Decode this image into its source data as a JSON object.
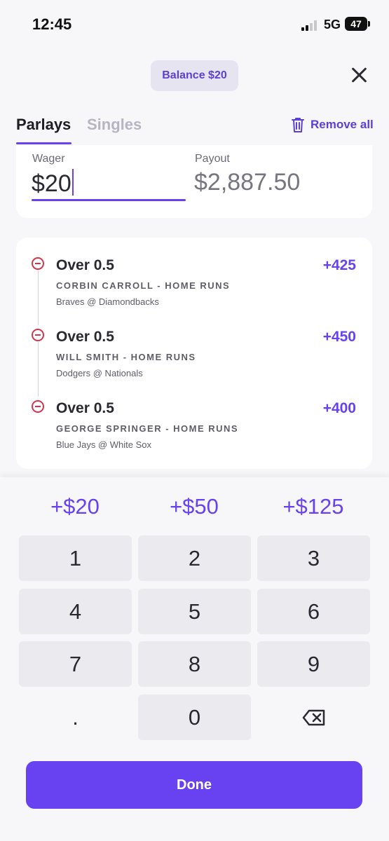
{
  "status_bar": {
    "time": "12:45",
    "network": "5G",
    "battery": "47"
  },
  "header": {
    "balance": "Balance $20"
  },
  "tabs": [
    {
      "label": "Parlays",
      "active": true
    },
    {
      "label": "Singles",
      "active": false
    }
  ],
  "remove_all_label": "Remove all",
  "wager": {
    "wager_label": "Wager",
    "wager_value": "$20",
    "payout_label": "Payout",
    "payout_value": "$2,887.50"
  },
  "legs": [
    {
      "title": "Over 0.5",
      "odds": "+425",
      "player": "CORBIN CARROLL - HOME RUNS",
      "game": "Braves @ Diamondbacks"
    },
    {
      "title": "Over 0.5",
      "odds": "+450",
      "player": "WILL SMITH - HOME RUNS",
      "game": "Dodgers @ Nationals"
    },
    {
      "title": "Over 0.5",
      "odds": "+400",
      "player": "GEORGE SPRINGER - HOME RUNS",
      "game": "Blue Jays @ White Sox"
    }
  ],
  "quick_amounts": [
    "+$20",
    "+$50",
    "+$125"
  ],
  "keypad": {
    "keys": [
      "1",
      "2",
      "3",
      "4",
      "5",
      "6",
      "7",
      "8",
      "9",
      ".",
      "0"
    ],
    "backspace_icon": "backspace-icon"
  },
  "done_label": "Done",
  "colors": {
    "accent": "#6842f0",
    "remove": "#d5344c",
    "background": "#f7f6f9"
  }
}
